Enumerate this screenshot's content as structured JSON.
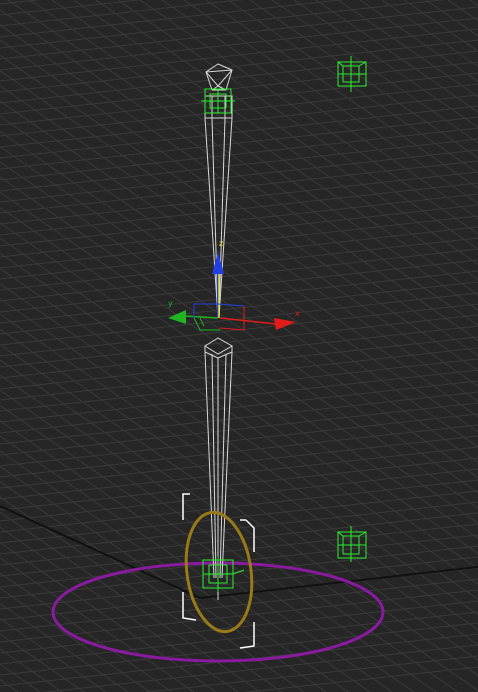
{
  "viewport": {
    "background": "#262626",
    "grid_color": "#3a3a3a",
    "grid_major_color": "#121212"
  },
  "gizmo": {
    "x_label": "x",
    "y_label": "y",
    "z_label": "z",
    "x_color": "#e21b1b",
    "y_color": "#22b422",
    "z_color": "#2240e0",
    "selected_axis_color": "#e8e02a"
  },
  "objects": {
    "bone_color": "#d8d8d8",
    "helper_color": "#2bee2b",
    "ik_circle_color": "#9a7a18",
    "ground_circle_color": "#8a1aa0",
    "selection_bracket_color": "#ffffff"
  }
}
